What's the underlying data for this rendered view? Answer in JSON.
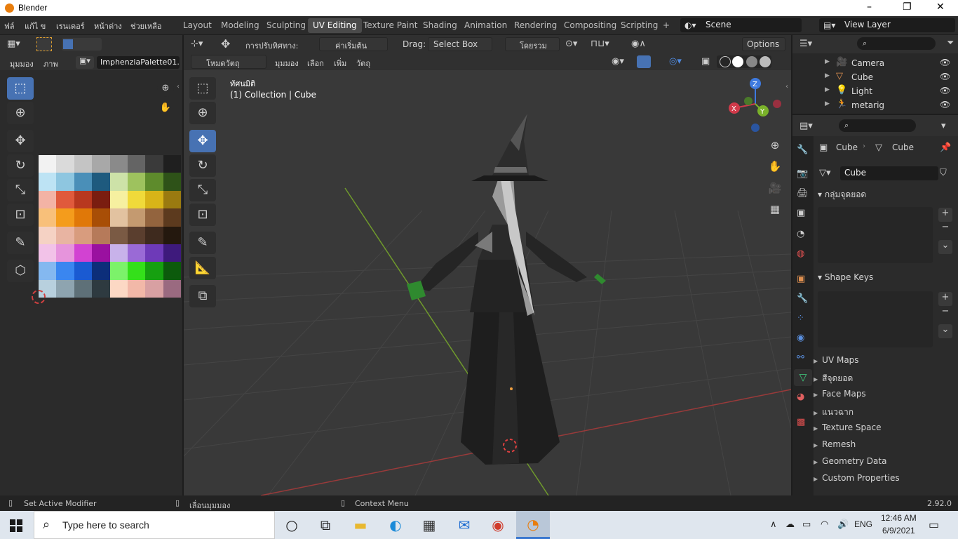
{
  "window": {
    "title": "Blender",
    "minimize": "–",
    "maximize": "❐",
    "close": "✕"
  },
  "menu": [
    "ฟล์",
    "แก้ไ ข",
    "เรนเดอร์",
    "หน้าต่าง",
    "ช่วยเหลือ"
  ],
  "workspaces": [
    "Layout",
    "Modeling",
    "Sculpting",
    "UV Editing",
    "Texture Paint",
    "Shading",
    "Animation",
    "Rendering",
    "Compositing",
    "Scripting"
  ],
  "active_workspace": "UV Editing",
  "add_tab": "+",
  "scene": "Scene",
  "view_layer": "View Layer",
  "image_editor": {
    "view_menu": "มุมมอง",
    "image_menu": "ภาพ",
    "image_name": "ImphenziaPalette01..."
  },
  "palette_colors": [
    [
      "#f2f2f2",
      "#dadada",
      "#c4c4c4",
      "#a8a8a8",
      "#8a8a8a",
      "#646464",
      "#3a3a3a",
      "#1f1f1f"
    ],
    [
      "#bde3f4",
      "#8ec6e0",
      "#4a8fb8",
      "#1e5a7e",
      "#cde2a8",
      "#9ec25e",
      "#5e8b2c",
      "#2e5218"
    ],
    [
      "#f3b3a5",
      "#e05a3c",
      "#b8381f",
      "#7a1d10",
      "#f6f0a0",
      "#f0da3a",
      "#d8b418",
      "#9a7a10"
    ],
    [
      "#f8c07a",
      "#f49c1c",
      "#e07808",
      "#a84e06",
      "#e2c2a0",
      "#c49a70",
      "#93643e",
      "#5c3a1e"
    ],
    [
      "#f5d2c4",
      "#e8b4a2",
      "#d89c7e",
      "#b67a5a",
      "#7a5a44",
      "#5a3e2e",
      "#3e2a1e",
      "#24180e"
    ],
    [
      "#f2c2e8",
      "#e694dc",
      "#d242d2",
      "#9a10a0",
      "#c8b2ea",
      "#9a6ad6",
      "#6e3ab8",
      "#3e1a7c"
    ],
    [
      "#84b8f0",
      "#3a86f0",
      "#1a5ad2",
      "#0c2e7a",
      "#7cf26a",
      "#34e01a",
      "#16a010",
      "#0c5a0c"
    ],
    [
      "#b8d0de",
      "#8ea4b0",
      "#5e7078",
      "#2e3a40",
      "#fcd8c4",
      "#f2b8a8",
      "#d8a0a2",
      "#9a6a80"
    ]
  ],
  "viewport": {
    "transform_label": "การปรับทิศทาง:",
    "transform_value": "ค่าเริ่มต้น",
    "drag_label": "Drag:",
    "drag_value": "Select Box",
    "orientation_value": "โดยรวม",
    "options": "Options",
    "mode": "โหมดวัตถุ",
    "view": "มุมมอง",
    "select": "เลือก",
    "add": "เพิ่ม",
    "object": "วัตถุ",
    "overlay_title": "ทัศนมิติ",
    "overlay_sub": "(1) Collection | Cube",
    "gizmo": {
      "x": "X",
      "y": "Y",
      "z": "Z"
    }
  },
  "outliner": {
    "items": [
      {
        "name": "Camera",
        "icon": "camera-icon",
        "color": "#e09050"
      },
      {
        "name": "Cube",
        "icon": "cube-icon",
        "color": "#e09050"
      },
      {
        "name": "Light",
        "icon": "light-icon",
        "color": "#e09050"
      },
      {
        "name": "metarig",
        "icon": "armature-icon",
        "color": "#e09050"
      }
    ]
  },
  "properties": {
    "breadcrumb_obj": "Cube",
    "breadcrumb_data": "Cube",
    "mesh_name": "Cube",
    "vertex_groups": "กลุ่มจุดยอด",
    "shape_keys": "Shape Keys",
    "collapsed": [
      "UV Maps",
      "สีจุดยอด",
      "Face Maps",
      "แนวฉาก",
      "Texture Space",
      "Remesh",
      "Geometry Data",
      "Custom Properties"
    ]
  },
  "statusbar": {
    "left": "Set Active Modifier",
    "middle": "เลื่อนมุมมอง",
    "right": "Context Menu",
    "version": "2.92.0"
  },
  "taskbar": {
    "search_placeholder": "Type here to search",
    "lang": "ENG",
    "time": "12:46 AM",
    "date": "6/9/2021"
  },
  "colors": {
    "accent": "#4772b3",
    "panel": "#303030",
    "viewport": "#3a3a3a"
  }
}
